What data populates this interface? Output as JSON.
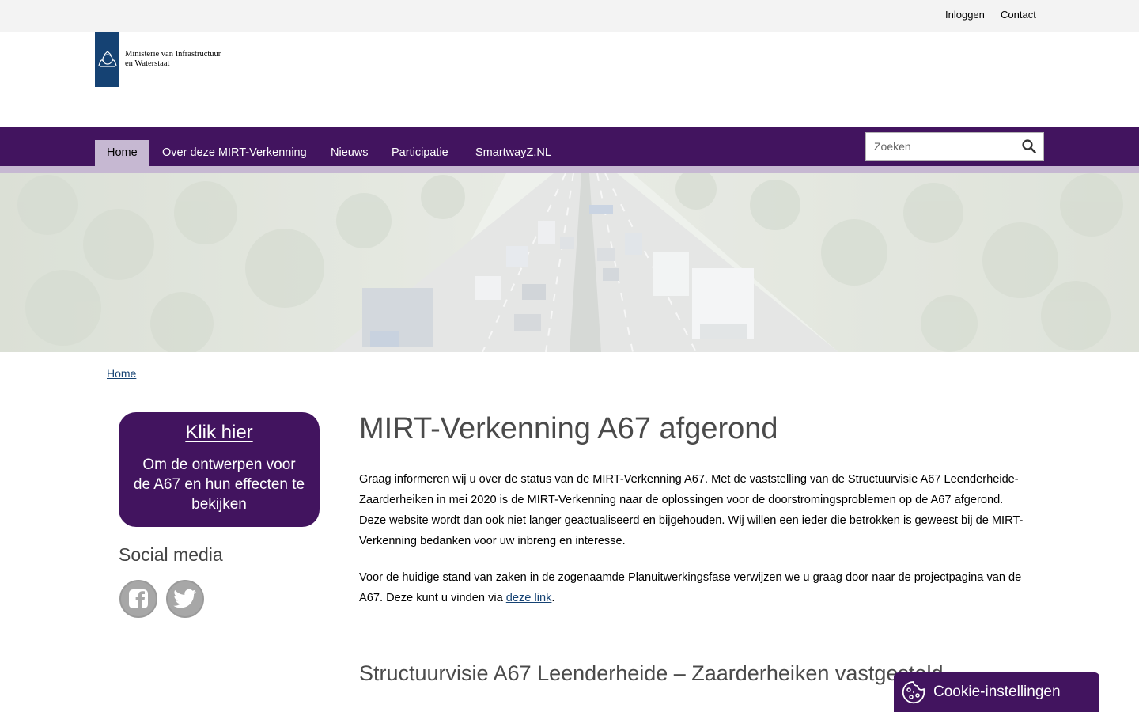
{
  "topbar": {
    "login_label": "Inloggen",
    "contact_label": "Contact"
  },
  "logo": {
    "line1": "Ministerie van Infrastructuur",
    "line2": "en Waterstaat"
  },
  "nav": {
    "items": [
      {
        "label": "Home"
      },
      {
        "label": "Over deze MIRT-Verkenning"
      },
      {
        "label": "Nieuws"
      },
      {
        "label": "Participatie"
      },
      {
        "label": "SmartwayZ.NL"
      }
    ],
    "search_placeholder": "Zoeken"
  },
  "breadcrumb": {
    "home": "Home"
  },
  "sidebar": {
    "klik_title": "Klik hier",
    "klik_text": "Om de ontwerpen voor de A67 en hun effecten te bekijken",
    "social_title": "Social media"
  },
  "main": {
    "title": "MIRT-Verkenning A67 afgerond",
    "paragraph1": "Graag informeren wij u over de status van de MIRT-Verkenning A67. Met de vaststelling van de Structuurvisie A67 Leenderheide-Zaarderheiken in mei 2020 is de MIRT-Verkenning naar de oplossingen voor de doorstromingsproblemen op de A67 afgerond. Deze website wordt dan ook niet langer geactualiseerd en bijgehouden. Wij willen een ieder die betrokken is geweest bij de MIRT-Verkenning bedanken voor uw inbreng en interesse.",
    "paragraph2_prefix": "Voor de huidige stand van zaken in de zogenaamde Planuitwerkingsfase verwijzen we u graag door naar de projectpagina van de A67. Deze kunt u vinden via ",
    "paragraph2_link": "deze link",
    "paragraph2_suffix": ".",
    "subtitle": "Structuurvisie A67 Leenderheide – Zaarderheiken vastgesteld"
  },
  "cookie": {
    "label": "Cookie-instellingen"
  },
  "colors": {
    "brand_purple": "#42145f",
    "nav_light": "#c6b8d2",
    "logo_blue": "#154273"
  }
}
